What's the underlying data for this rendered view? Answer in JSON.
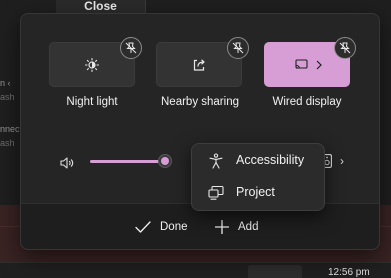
{
  "background": {
    "close_label": "Close",
    "edge_texts": [
      "n ‹",
      "ash",
      "nnect",
      "ash"
    ],
    "clock": "12:56 pm"
  },
  "quick_settings": {
    "tiles": [
      {
        "label": "Night light",
        "icon": "brightness-icon",
        "active": false,
        "pin_icon": "unpin-icon"
      },
      {
        "label": "Nearby sharing",
        "icon": "share-icon",
        "active": false,
        "pin_icon": "unpin-icon"
      },
      {
        "label": "Wired display",
        "icon": "cast-icon",
        "active": true,
        "has_chevron": true,
        "pin_icon": "unpin-icon"
      }
    ],
    "volume": {
      "level_fraction": 0.38,
      "icon": "volume-icon",
      "output_icon": "speaker-icon",
      "chevron": "›"
    },
    "footer": {
      "done_label": "Done",
      "add_label": "Add"
    },
    "add_menu": {
      "items": [
        {
          "label": "Accessibility",
          "icon": "accessibility-icon"
        },
        {
          "label": "Project",
          "icon": "project-icon"
        }
      ]
    },
    "colors": {
      "accent": "#d79ed6",
      "flyout_bg": "#252525",
      "tile_bg": "#333333"
    }
  }
}
